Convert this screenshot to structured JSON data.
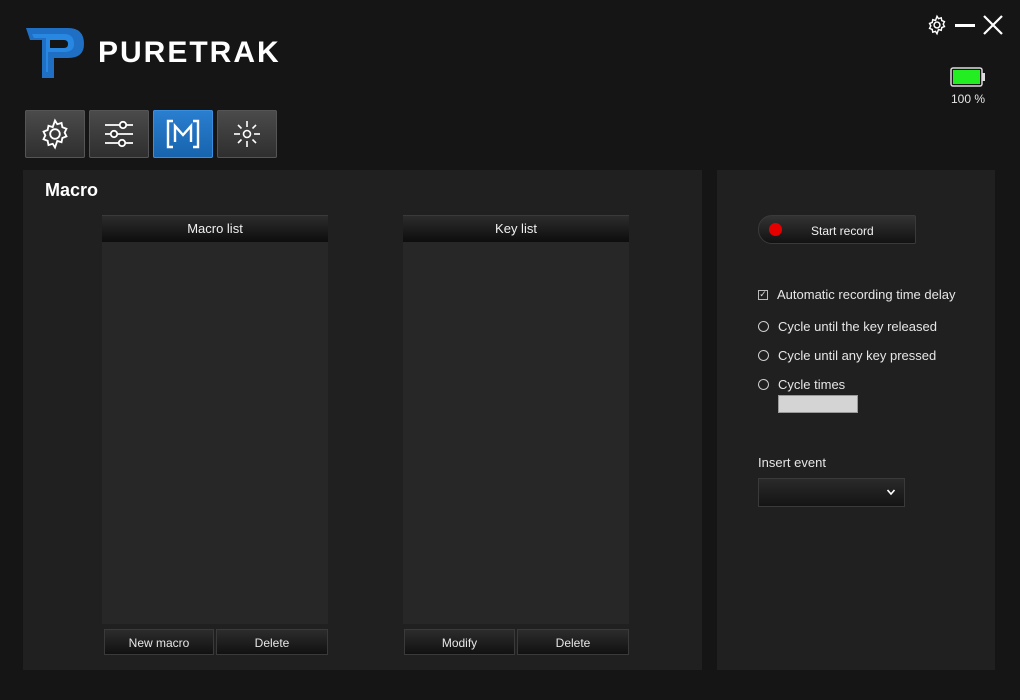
{
  "app": {
    "brand": "PURETRAK",
    "battery_text": "100 %",
    "battery_level": 1.0,
    "colors": {
      "accent": "#1a6fc2",
      "battery_fill": "#22ee22",
      "record_dot": "#e50000"
    }
  },
  "window_controls": [
    {
      "name": "settings",
      "icon": "gear-icon"
    },
    {
      "name": "minimize",
      "icon": "minimize-icon"
    },
    {
      "name": "close",
      "icon": "close-icon"
    }
  ],
  "tabs": [
    {
      "icon": "gear-icon",
      "active": false
    },
    {
      "icon": "sliders-icon",
      "active": false
    },
    {
      "icon": "macro-m-icon",
      "active": true
    },
    {
      "icon": "lighting-icon",
      "active": false
    }
  ],
  "macro": {
    "title": "Macro",
    "macro_list": {
      "header": "Macro list",
      "items": [],
      "new_label": "New macro",
      "delete_label": "Delete"
    },
    "key_list": {
      "header": "Key list",
      "items": [],
      "modify_label": "Modify",
      "delete_label": "Delete"
    }
  },
  "recording": {
    "start_label": "Start record",
    "auto_delay": {
      "label": "Automatic recording time delay",
      "checked": true
    },
    "options": [
      {
        "label": "Cycle until the key released",
        "selected": false
      },
      {
        "label": "Cycle until any key pressed",
        "selected": false
      },
      {
        "label": "Cycle times",
        "selected": false
      }
    ],
    "cycle_times_value": "",
    "insert_event": {
      "label": "Insert event",
      "value": ""
    }
  }
}
